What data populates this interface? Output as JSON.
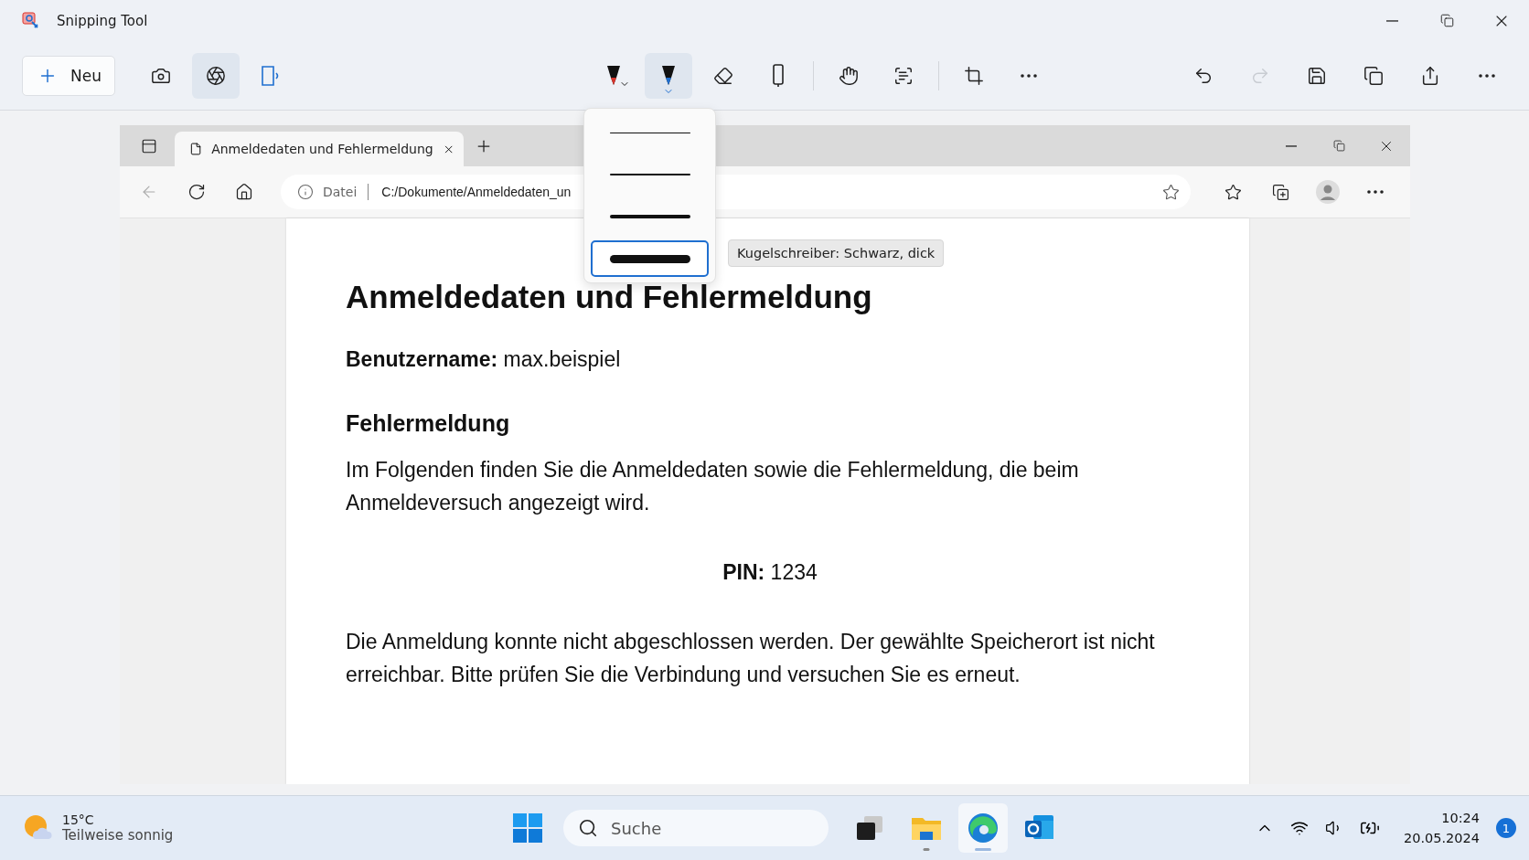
{
  "window": {
    "title": "Snipping Tool"
  },
  "toolbar": {
    "new_button": {
      "label": "Neu"
    },
    "capture_modes": [
      {
        "kind": "photo",
        "selected": false
      },
      {
        "kind": "photo-settings",
        "selected": true
      },
      {
        "kind": "video",
        "selected": false
      }
    ],
    "tool_groups": [
      {
        "items": [
          {
            "kind": "pen",
            "selected": false
          },
          {
            "kind": "pen",
            "selected": true
          },
          {
            "kind": "eraser",
            "selected": false
          },
          {
            "kind": "ruler",
            "selected": false
          }
        ]
      },
      {
        "items": [
          {
            "kind": "touch",
            "selected": false
          },
          {
            "kind": "text-actions",
            "selected": false
          }
        ]
      },
      {
        "items": [
          {
            "kind": "crop",
            "selected": false
          },
          {
            "kind": "more",
            "selected": false
          }
        ]
      }
    ],
    "actions": [
      {
        "kind": "undo",
        "disabled": false
      },
      {
        "kind": "redo",
        "disabled": true
      },
      {
        "kind": "save",
        "disabled": false
      },
      {
        "kind": "copy",
        "disabled": false
      },
      {
        "kind": "share",
        "disabled": false
      },
      {
        "kind": "more",
        "disabled": false
      }
    ]
  },
  "pen_menu": {
    "thicknesses": [
      {
        "kind": "thin",
        "selected": false
      },
      {
        "kind": "medium",
        "selected": false
      },
      {
        "kind": "thick",
        "selected": false
      },
      {
        "kind": "extra-thick",
        "selected": true
      }
    ],
    "tooltip": "Kugelschreiber: Schwarz, dick"
  },
  "browser": {
    "tab": {
      "title": "Anmeldedaten und Fehlermeldung"
    },
    "address": {
      "scheme_label": "Datei",
      "url": "C:/Dokumente/Anmeldedaten_un"
    },
    "page": {
      "heading": "Anmeldedaten und Fehlermeldung",
      "username_line": "**Benutzername:** max.beispiel",
      "subheading": "Fehlermeldung",
      "intro": "Im Folgenden finden Sie die Anmeldedaten sowie die Fehlermeldung, die beim Anmeldeversuch angezeigt wird.",
      "pin_line": "**PIN:** 1234",
      "error": "Die Anmeldung konnte nicht abgeschlossen werden. Der gewählte Speicherort ist nicht erreichbar. Bitte prüfen Sie die Verbindung und versuchen Sie es erneut."
    }
  },
  "taskbar": {
    "weather": {
      "temperature": "15°C",
      "condition": "Teilweise sonnig"
    },
    "search": {
      "placeholder": "Suche"
    },
    "apps": [
      {
        "kind": "task-view",
        "running": false,
        "selected": false
      },
      {
        "kind": "folder",
        "running": true,
        "selected": false
      },
      {
        "kind": "edge",
        "running": true,
        "selected": true
      },
      {
        "kind": "outlook",
        "running": false,
        "selected": false
      }
    ],
    "time": "10:24",
    "date": "20.05.2024",
    "notifications": "1"
  }
}
